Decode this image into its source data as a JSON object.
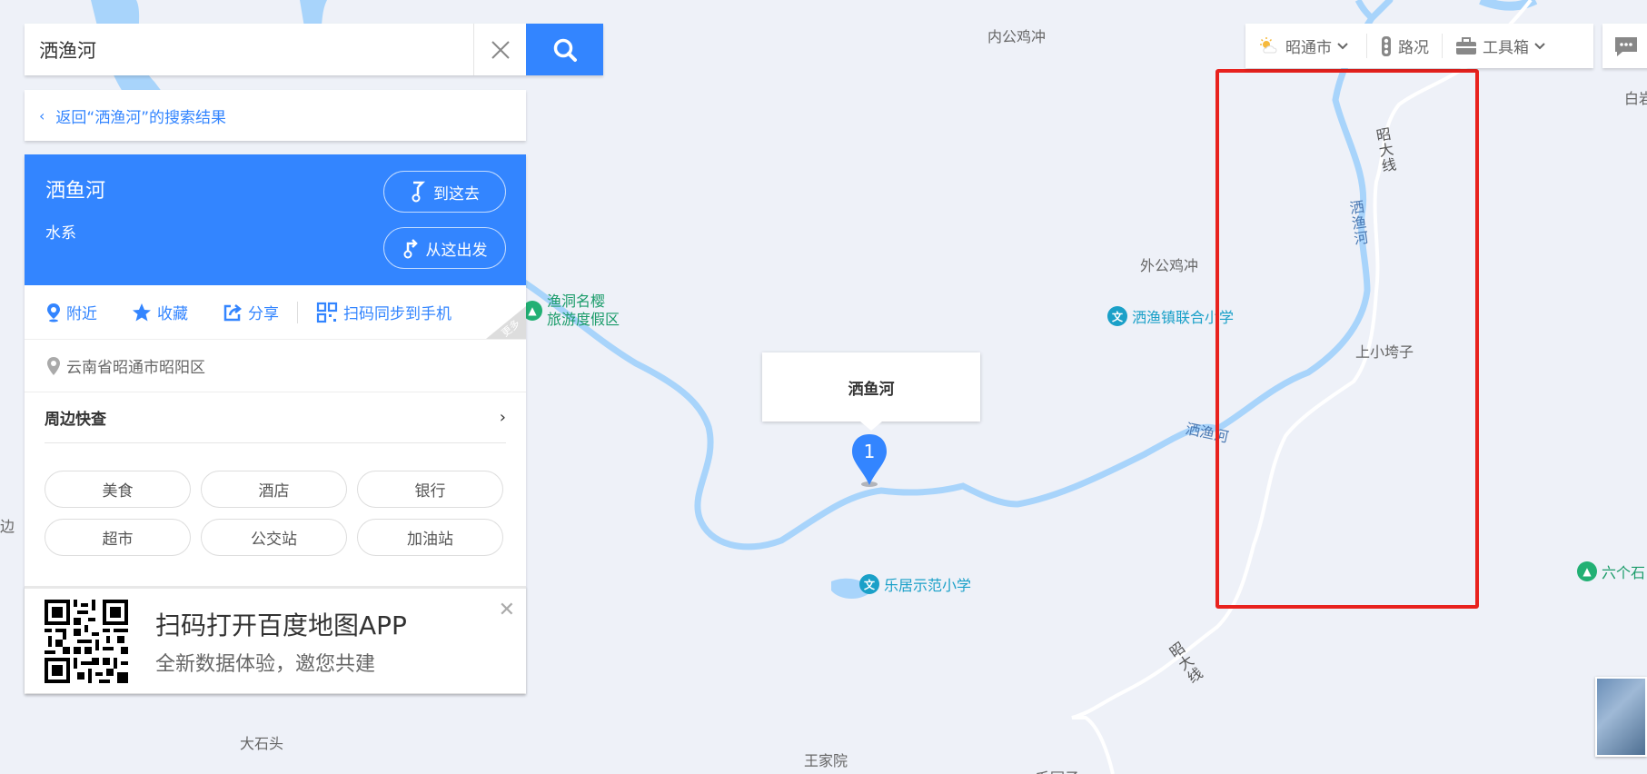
{
  "search": {
    "value": "洒渔河",
    "placeholder": ""
  },
  "back_link": {
    "label": "返回“洒渔河”的搜索结果"
  },
  "place": {
    "name": "洒鱼河",
    "type": "水系",
    "go_here": "到这去",
    "from_here": "从这出发",
    "actions": [
      "附近",
      "收藏",
      "分享",
      "扫码同步到手机"
    ],
    "more_corner": "更多",
    "address": "云南省昭通市昭阳区",
    "nearby_title": "周边快查",
    "chips": [
      "美食",
      "酒店",
      "银行",
      "超市",
      "公交站",
      "加油站"
    ]
  },
  "qr_banner": {
    "title": "扫码打开百度地图APP",
    "subtitle": "全新数据体验，邀您共建"
  },
  "toolbar": {
    "city": "昭通市",
    "traffic": "路况",
    "toolbox": "工具箱"
  },
  "marker": {
    "number": "1",
    "popup_title": "洒鱼河"
  },
  "map_labels": {
    "neigong": "内公鸡冲",
    "waigong": "外公鸡冲",
    "shangxiao": "上小垮子",
    "dashitou": "大石头",
    "wangjiayuan": "王家院",
    "bai": "白岩",
    "bian": "边",
    "river_main": "洒渔河",
    "river_vert": "洒渔河",
    "road_top": "昭大线",
    "road_bottom": "昭大线",
    "bottom_cut": "毛园子"
  },
  "pois": {
    "resort": "渔洞名樱\n旅游度假区",
    "school1": "洒渔镇联合小学",
    "school2": "乐居示范小学",
    "liuge": "六个石"
  },
  "colors": {
    "accent": "#3385ff",
    "highlight": "#e8221e",
    "river": "#a8d4fb"
  }
}
